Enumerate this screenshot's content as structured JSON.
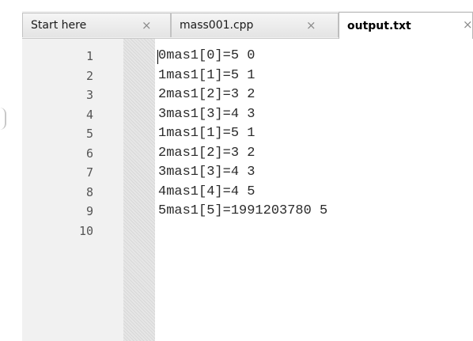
{
  "tabs": [
    {
      "label": "Start here",
      "close": "×"
    },
    {
      "label": "mass001.cpp",
      "close": "×"
    },
    {
      "label": "output.txt",
      "close": "×",
      "active": true
    }
  ],
  "editor": {
    "line_numbers": [
      "1",
      "2",
      "3",
      "4",
      "5",
      "6",
      "7",
      "8",
      "9",
      "10"
    ],
    "lines": [
      "0mas1[0]=5 0",
      "1mas1[1]=5 1",
      "2mas1[2]=3 2",
      "3mas1[3]=4 3",
      "1mas1[1]=5 1",
      "2mas1[2]=3 2",
      "3mas1[3]=4 3",
      "4mas1[4]=4 5",
      "5mas1[5]=1991203780 5",
      ""
    ]
  }
}
